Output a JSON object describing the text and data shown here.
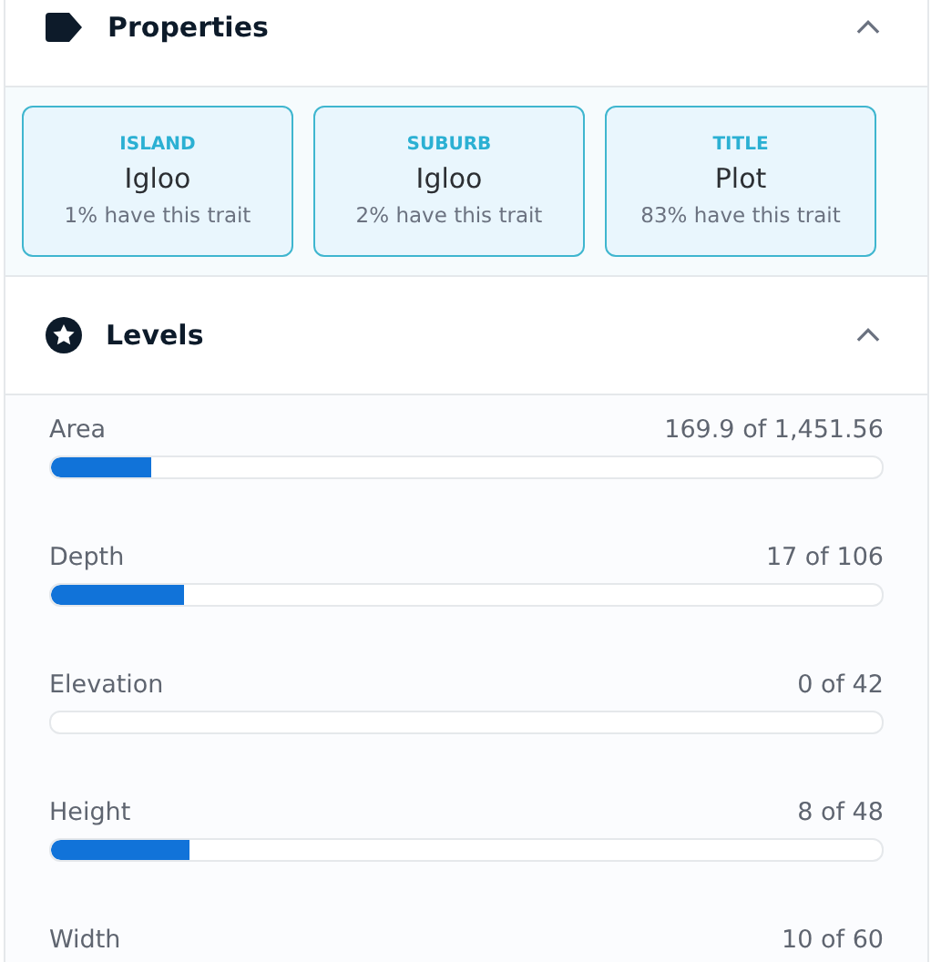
{
  "properties": {
    "title": "Properties",
    "expanded": true,
    "traits": [
      {
        "type": "ISLAND",
        "value": "Igloo",
        "rarity": "1% have this trait"
      },
      {
        "type": "SUBURB",
        "value": "Igloo",
        "rarity": "2% have this trait"
      },
      {
        "type": "TITLE",
        "value": "Plot",
        "rarity": "83% have this trait"
      }
    ]
  },
  "levels": {
    "title": "Levels",
    "expanded": true,
    "items": [
      {
        "kind": "meter",
        "name": "Area",
        "reading": "169.9 of 1,451.56",
        "level": 0.12
      },
      {
        "kind": "meter",
        "name": "Depth",
        "reading": "17 of 106",
        "level": 0.16
      },
      {
        "kind": "meter",
        "name": "Elevation",
        "reading": "0 of 42"
      },
      {
        "kind": "meter",
        "name": "Height",
        "reading": "8 of 48",
        "level": 0.167
      },
      {
        "kind": "text",
        "name": "Width",
        "reading": "10 of 60"
      }
    ]
  }
}
